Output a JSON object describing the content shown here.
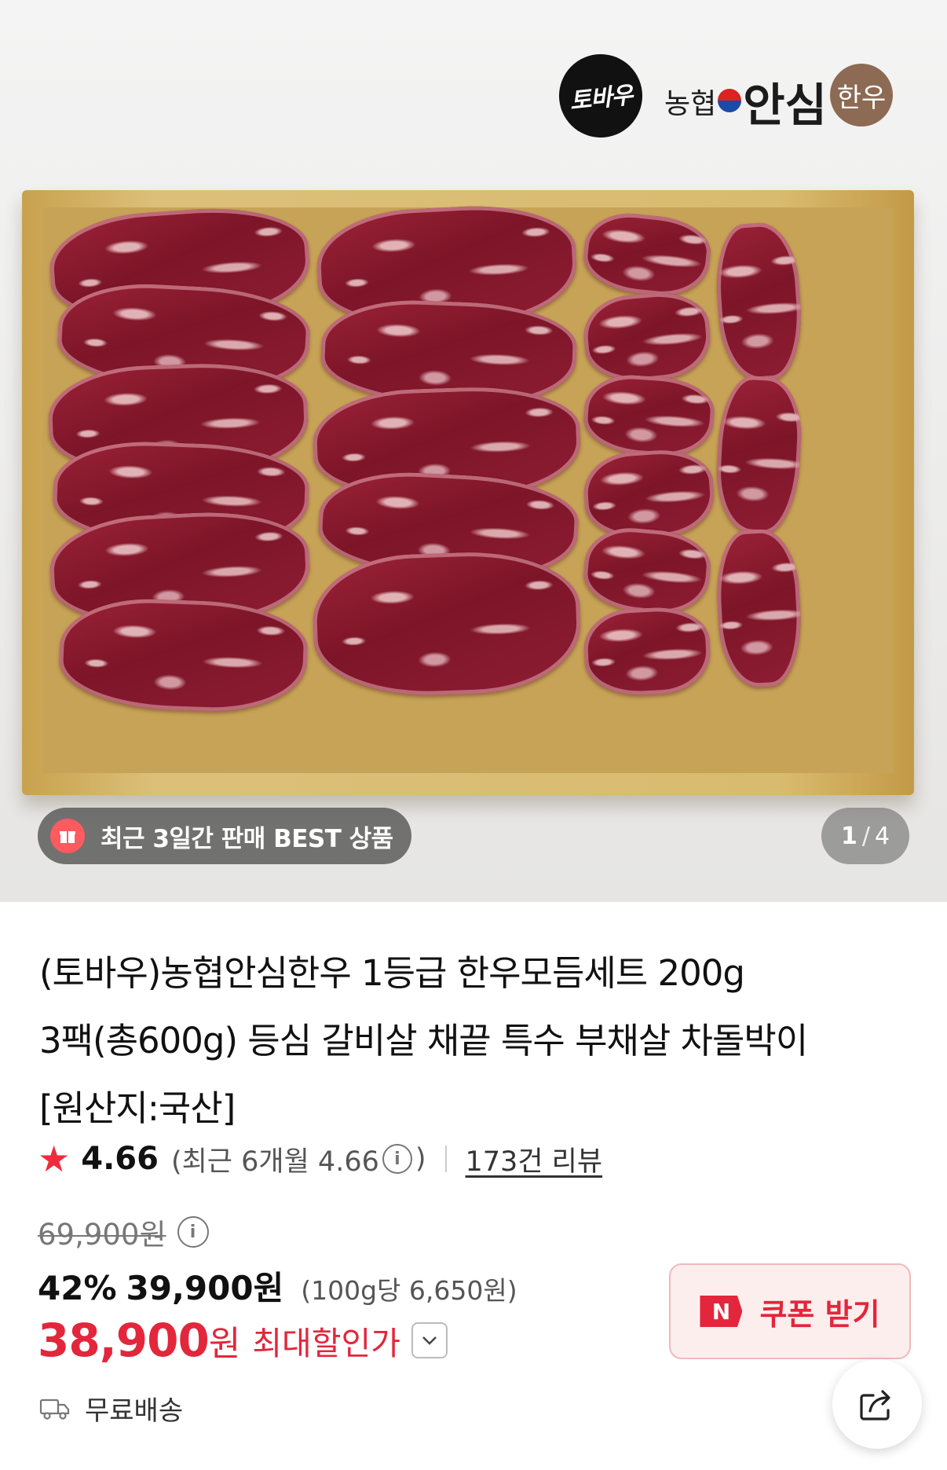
{
  "brand": {
    "emblem_text": "토바우",
    "name_small": "농협",
    "name_big": "안심",
    "name_badge": "한우"
  },
  "image": {
    "best_badge": "최근 3일간 판매 BEST 상품",
    "page_current": "1",
    "page_total": "4"
  },
  "product": {
    "title_line1": "(토바우)농협안심한우 1등급 한우모듬세트 200g",
    "title_line2": "3팩(총600g) 등심 갈비살 채끝 특수 부채살 차돌박이",
    "title_line3": "[원산지:국산]"
  },
  "rating": {
    "score": "4.66",
    "recent_prefix": "(최근 6개월 4.66",
    "recent_suffix": ")",
    "review_count": "173건 리뷰"
  },
  "price": {
    "original": "69,900원",
    "discount_pct": "42%",
    "sale": "39,900원",
    "unit": "(100g당 6,650원)",
    "max_discount": "38,900",
    "max_discount_unit": "원",
    "max_discount_label": "최대할인가"
  },
  "coupon": {
    "logo": "N",
    "label": "쿠폰 받기"
  },
  "shipping": {
    "label": "무료배송"
  },
  "colors": {
    "accent_red": "#e3263b",
    "star": "#ef2b3c"
  }
}
